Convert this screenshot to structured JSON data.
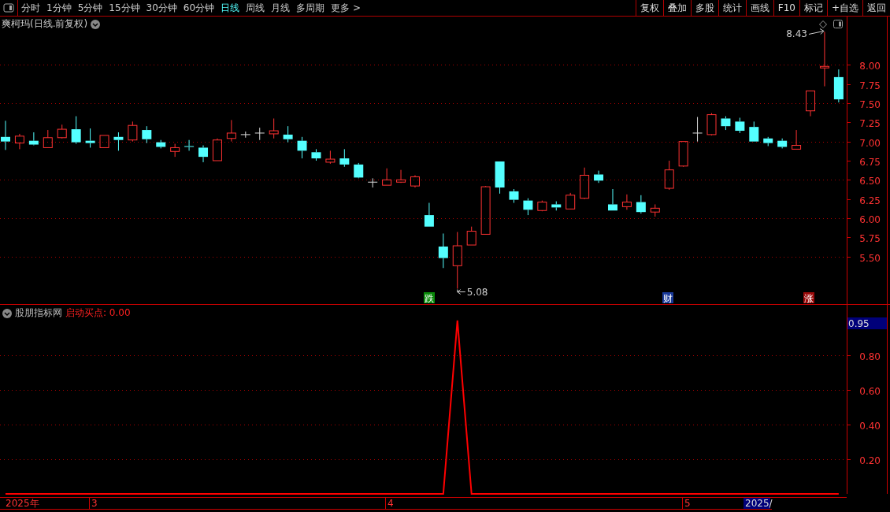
{
  "toolbar": {
    "periods": [
      {
        "label": "分时",
        "selected": false
      },
      {
        "label": "1分钟",
        "selected": false
      },
      {
        "label": "5分钟",
        "selected": false
      },
      {
        "label": "15分钟",
        "selected": false
      },
      {
        "label": "30分钟",
        "selected": false
      },
      {
        "label": "60分钟",
        "selected": false
      },
      {
        "label": "日线",
        "selected": true
      },
      {
        "label": "周线",
        "selected": false
      },
      {
        "label": "月线",
        "selected": false
      },
      {
        "label": "多周期",
        "selected": false
      },
      {
        "label": "更多 >",
        "selected": false
      }
    ],
    "actions": [
      "复权",
      "叠加",
      "多股",
      "统计",
      "画线",
      "F10",
      "标记",
      "+自选",
      "返回"
    ]
  },
  "price_panel": {
    "title": "爽柯玛(日线.前复权)",
    "chart_data": {
      "type": "candlestick",
      "grid": true,
      "ylim": [
        4.88,
        8.63
      ],
      "yticks": [
        {
          "value": 5.5,
          "label": "5.50"
        },
        {
          "value": 5.75,
          "label": "5.75"
        },
        {
          "value": 6,
          "label": "6.00"
        },
        {
          "value": 6.25,
          "label": "6.25"
        },
        {
          "value": 6.5,
          "label": "6.50"
        },
        {
          "value": 6.75,
          "label": "6.75"
        },
        {
          "value": 7,
          "label": "7.00"
        },
        {
          "value": 7.25,
          "label": "7.25"
        },
        {
          "value": 7.5,
          "label": "7.50"
        },
        {
          "value": 7.75,
          "label": "7.75"
        },
        {
          "value": 8,
          "label": "8.00"
        }
      ],
      "ohlc": [
        [
          7.06,
          7.27,
          6.89,
          7.0
        ],
        [
          6.98,
          7.1,
          6.9,
          7.07
        ],
        [
          7.01,
          7.12,
          6.95,
          6.96
        ],
        [
          6.92,
          7.15,
          6.92,
          7.05
        ],
        [
          7.05,
          7.22,
          7.04,
          7.16
        ],
        [
          7.16,
          7.33,
          6.97,
          6.99
        ],
        [
          7.01,
          7.17,
          6.92,
          6.98
        ],
        [
          6.92,
          7.08,
          6.92,
          7.08
        ],
        [
          7.06,
          7.12,
          6.88,
          7.02
        ],
        [
          7.02,
          7.26,
          7.0,
          7.21
        ],
        [
          7.15,
          7.2,
          6.98,
          7.03
        ],
        [
          6.99,
          7.02,
          6.91,
          6.93
        ],
        [
          6.87,
          6.97,
          6.8,
          6.92
        ],
        [
          6.94,
          7.02,
          6.88,
          6.93
        ],
        [
          6.92,
          6.95,
          6.73,
          6.8
        ],
        [
          6.75,
          7.04,
          6.75,
          7.02
        ],
        [
          7.04,
          7.28,
          7.0,
          7.11
        ],
        [
          7.09,
          7.13,
          7.05,
          7.09
        ],
        [
          7.11,
          7.18,
          7.02,
          7.11
        ],
        [
          7.1,
          7.3,
          7.04,
          7.14
        ],
        [
          7.09,
          7.2,
          6.99,
          7.03
        ],
        [
          7.01,
          7.06,
          6.78,
          6.88
        ],
        [
          6.86,
          6.9,
          6.75,
          6.78
        ],
        [
          6.73,
          6.88,
          6.71,
          6.77
        ],
        [
          6.78,
          6.9,
          6.67,
          6.7
        ],
        [
          6.7,
          6.72,
          6.52,
          6.53
        ],
        [
          6.47,
          6.52,
          6.4,
          6.47
        ],
        [
          6.43,
          6.65,
          6.43,
          6.5
        ],
        [
          6.47,
          6.63,
          6.46,
          6.5
        ],
        [
          6.42,
          6.56,
          6.4,
          6.54
        ],
        [
          6.04,
          6.2,
          5.89,
          5.89
        ],
        [
          5.63,
          5.8,
          5.35,
          5.48
        ],
        [
          5.38,
          5.82,
          5.08,
          5.64
        ],
        [
          5.65,
          5.89,
          5.65,
          5.83
        ],
        [
          5.79,
          6.42,
          5.79,
          6.41
        ],
        [
          6.74,
          6.74,
          6.32,
          6.4
        ],
        [
          6.35,
          6.38,
          6.2,
          6.24
        ],
        [
          6.23,
          6.26,
          6.04,
          6.11
        ],
        [
          6.1,
          6.23,
          6.09,
          6.21
        ],
        [
          6.18,
          6.22,
          6.1,
          6.14
        ],
        [
          6.12,
          6.33,
          6.12,
          6.3
        ],
        [
          6.26,
          6.66,
          6.25,
          6.56
        ],
        [
          6.57,
          6.62,
          6.46,
          6.49
        ],
        [
          6.18,
          6.38,
          6.1,
          6.1
        ],
        [
          6.15,
          6.31,
          6.11,
          6.21
        ],
        [
          6.21,
          6.3,
          6.06,
          6.08
        ],
        [
          6.08,
          6.18,
          6.02,
          6.13
        ],
        [
          6.39,
          6.75,
          6.37,
          6.63
        ],
        [
          6.68,
          7.0,
          6.67,
          7.0
        ],
        [
          7.11,
          7.32,
          7.0,
          7.11
        ],
        [
          7.09,
          7.37,
          7.08,
          7.35
        ],
        [
          7.3,
          7.33,
          7.15,
          7.2
        ],
        [
          7.26,
          7.31,
          7.11,
          7.14
        ],
        [
          7.19,
          7.26,
          7.0,
          7.0
        ],
        [
          7.04,
          7.06,
          6.94,
          6.98
        ],
        [
          7.01,
          7.04,
          6.91,
          6.93
        ],
        [
          6.9,
          7.15,
          6.9,
          6.95
        ],
        [
          7.4,
          7.66,
          7.33,
          7.66
        ],
        [
          7.96,
          8.43,
          7.72,
          7.98
        ],
        [
          7.84,
          7.94,
          7.51,
          7.55
        ]
      ],
      "annotations": [
        "8.43",
        "5.08"
      ]
    },
    "event_flags": [
      {
        "text": "跌",
        "color": "#0a8a0a"
      },
      {
        "text": "财",
        "color": "#1a3a9a"
      },
      {
        "text": "涨",
        "color": "#9a0a0a"
      }
    ]
  },
  "indicator_panel": {
    "name": "股朋指标网",
    "reading": ": 0.00",
    "value_marker": "0.95",
    "chart_data": {
      "type": "line",
      "grid": true,
      "ylim": [
        0,
        1.09
      ],
      "yticks": [
        {
          "value": 0.2,
          "label": "0.20"
        },
        {
          "value": 0.4,
          "label": "0.40"
        },
        {
          "value": 0.6,
          "label": "0.60"
        },
        {
          "value": 0.8,
          "label": "0.80"
        }
      ],
      "series": [
        {
          "name": "启动买点",
          "color": "#ff0000",
          "values": [
            0,
            0,
            0,
            0,
            0,
            0,
            0,
            0,
            0,
            0,
            0,
            0,
            0,
            0,
            0,
            0,
            0,
            0,
            0,
            0,
            0,
            0,
            0,
            0,
            0,
            0,
            0,
            0,
            0,
            0,
            0,
            0,
            1,
            0,
            0,
            0,
            0,
            0,
            0,
            0,
            0,
            0,
            0,
            0,
            0,
            0,
            0,
            0,
            0,
            0,
            0,
            0,
            0,
            0,
            0,
            0,
            0,
            0,
            0,
            0
          ]
        }
      ]
    }
  },
  "date_axis": {
    "labels": [
      "2025年",
      "3",
      "4",
      "5"
    ],
    "cursor_date": "2025/"
  }
}
